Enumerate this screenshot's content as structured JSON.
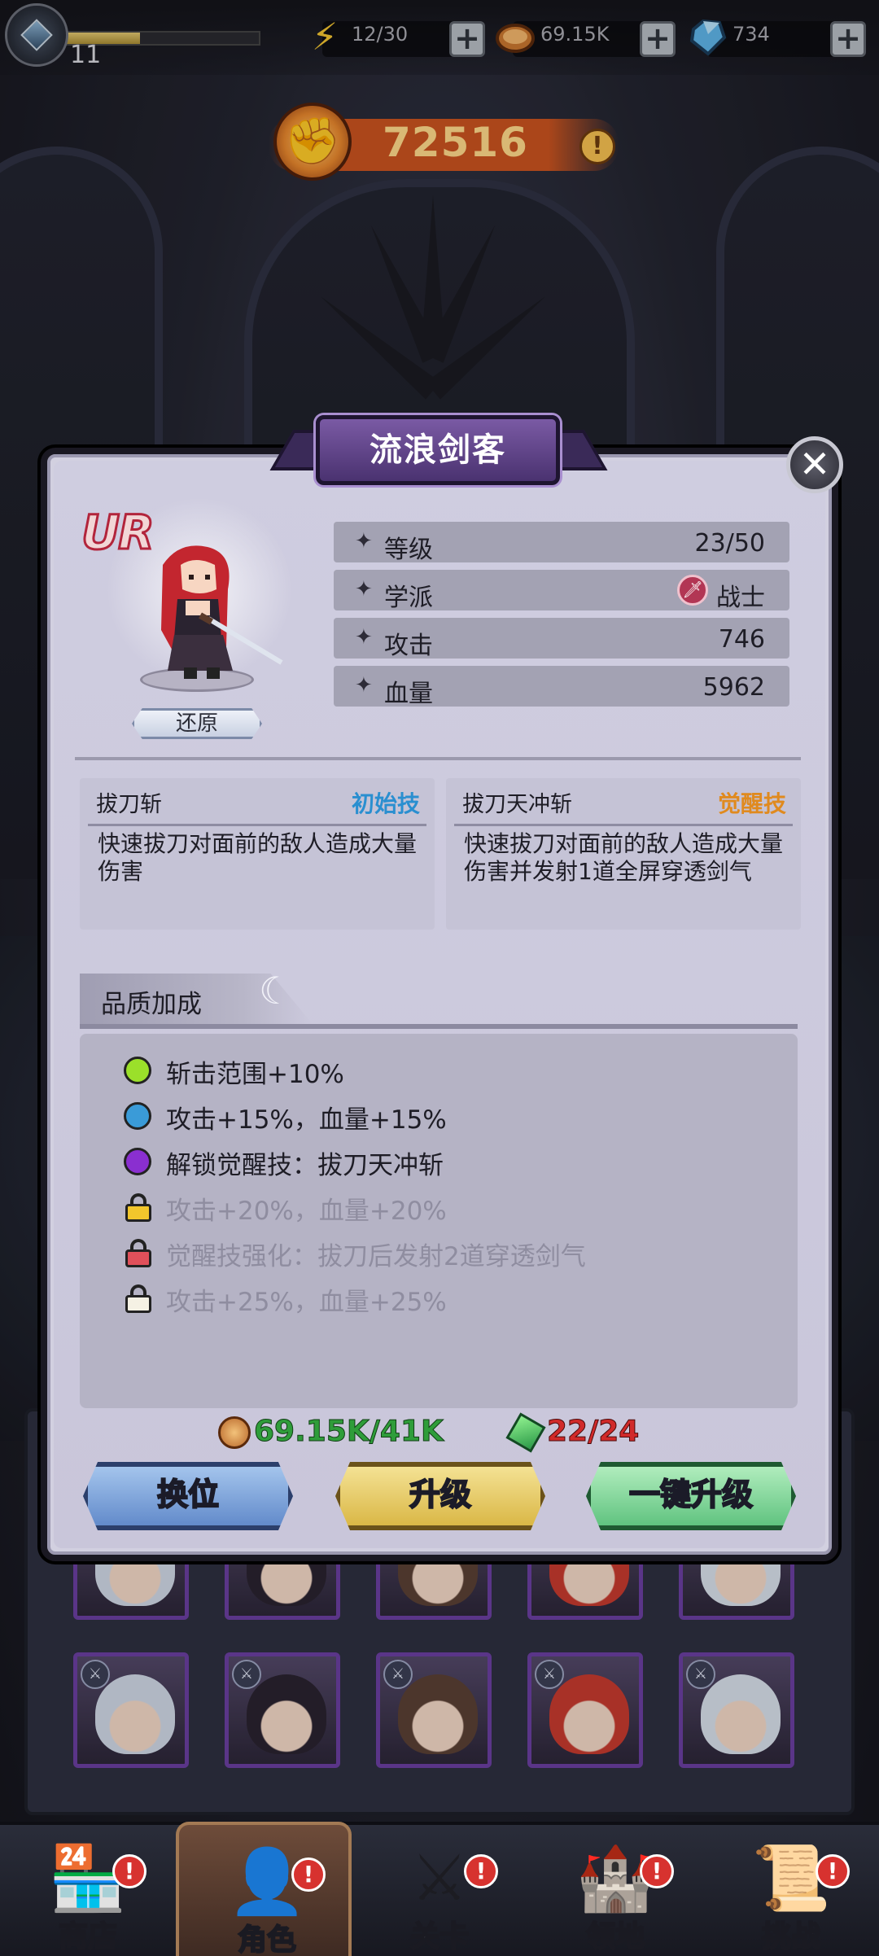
{
  "topbar": {
    "level": "11",
    "exp_fraction": 0.38,
    "energy": "12/30",
    "coins": "69.15K",
    "gems": "734",
    "energy_icon": "lightning-icon",
    "coin_icon": "coin-icon",
    "gem_icon": "diamond-icon"
  },
  "power": {
    "value": "72516",
    "icon": "fist-icon",
    "info": "!"
  },
  "hero": {
    "name": "流浪剑客",
    "rarity": "UR",
    "restore_label": "还原",
    "stats": [
      {
        "label": "等级",
        "value": "23/50"
      },
      {
        "label": "学派",
        "value": "战士"
      },
      {
        "label": "攻击",
        "value": "746"
      },
      {
        "label": "血量",
        "value": "5962"
      }
    ]
  },
  "skills": [
    {
      "name": "拔刀斩",
      "tag": "初始技",
      "tag_color": "#2a8fd0",
      "desc": "快速拔刀对面前的敌人造成大量伤害"
    },
    {
      "name": "拔刀天冲斩",
      "tag": "觉醒技",
      "tag_color": "#e08a1e",
      "desc": "快速拔刀对面前的敌人造成大量伤害并发射1道全屏穿透剑气"
    }
  ],
  "quality": {
    "title": "品质加成",
    "items": [
      {
        "text": "斩击范围+10%",
        "marker": "dot",
        "color": "#9be02a",
        "locked": false
      },
      {
        "text": "攻击+15%，血量+15%",
        "marker": "dot",
        "color": "#3a9bd8",
        "locked": false
      },
      {
        "text": "解锁觉醒技：拔刀天冲斩",
        "marker": "dot",
        "color": "#8a2fd0",
        "locked": false
      },
      {
        "text": "攻击+20%，血量+20%",
        "marker": "lock",
        "color": "#f2c62c",
        "locked": true
      },
      {
        "text": "觉醒技强化：拔刀后发射2道穿透剑气",
        "marker": "lock",
        "color": "#e0505a",
        "locked": true
      },
      {
        "text": "攻击+25%，血量+25%",
        "marker": "lock",
        "color": "#f5f1e4",
        "locked": true
      }
    ]
  },
  "costs": {
    "coins": "69.15K/41K",
    "shards": "22/24"
  },
  "actions": {
    "swap": "换位",
    "upgrade": "升级",
    "auto_upgrade": "一键升级"
  },
  "nav": [
    {
      "label": "商店",
      "icon": "shop-icon",
      "badge": "!"
    },
    {
      "label": "角色",
      "icon": "character-icon",
      "badge": "!"
    },
    {
      "label": "关卡",
      "icon": "crossed-swords-icon",
      "badge": "!"
    },
    {
      "label": "领地",
      "icon": "castle-icon",
      "badge": "!"
    },
    {
      "label": "挑战",
      "icon": "scroll-icon",
      "badge": "!"
    }
  ]
}
